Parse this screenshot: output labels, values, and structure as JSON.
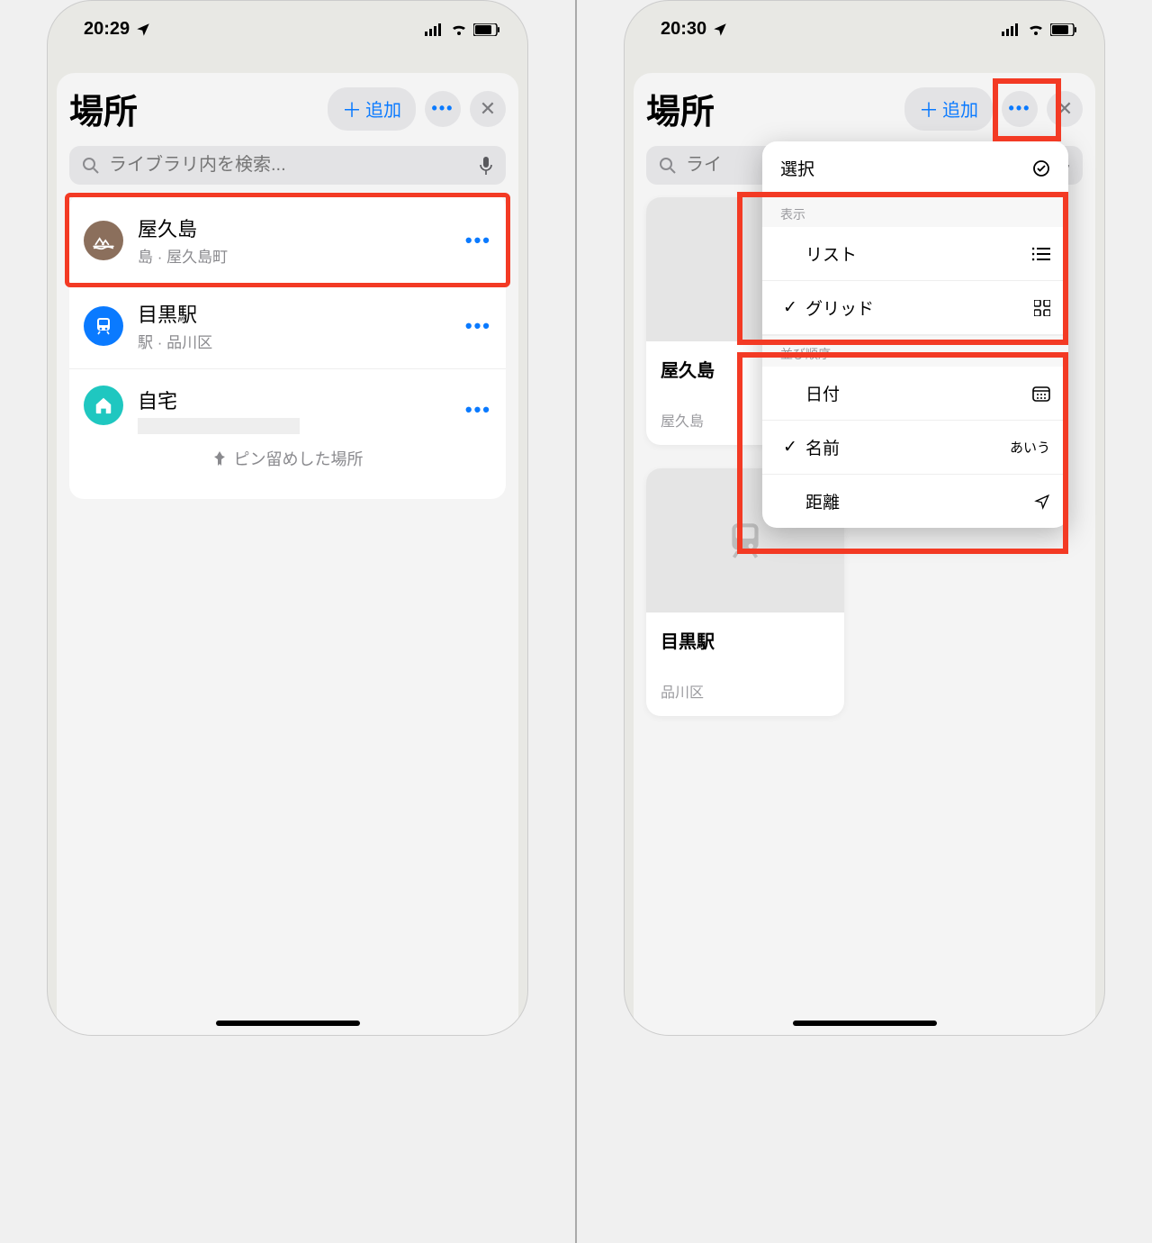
{
  "left": {
    "time": "20:29",
    "title": "場所",
    "add_label": "追加",
    "search_placeholder": "ライブラリ内を検索...",
    "items": [
      {
        "title": "屋久島",
        "sub": "島 · 屋久島町"
      },
      {
        "title": "目黒駅",
        "sub": "駅 · 品川区"
      },
      {
        "title": "自宅",
        "sub": ""
      }
    ],
    "pinned_label": "ピン留めした場所"
  },
  "right": {
    "time": "20:30",
    "title": "場所",
    "add_label": "追加",
    "search_placeholder_short": "ライ",
    "popover": {
      "select": "選択",
      "section_view": "表示",
      "list": "リスト",
      "grid": "グリッド",
      "section_sort": "並び順序",
      "date": "日付",
      "name": "名前",
      "name_trail": "あいう",
      "distance": "距離"
    },
    "cards": [
      {
        "title_partial": "屋久島",
        "sub_partial": "屋久島"
      },
      {
        "title": "目黒駅",
        "sub": "品川区"
      }
    ]
  }
}
